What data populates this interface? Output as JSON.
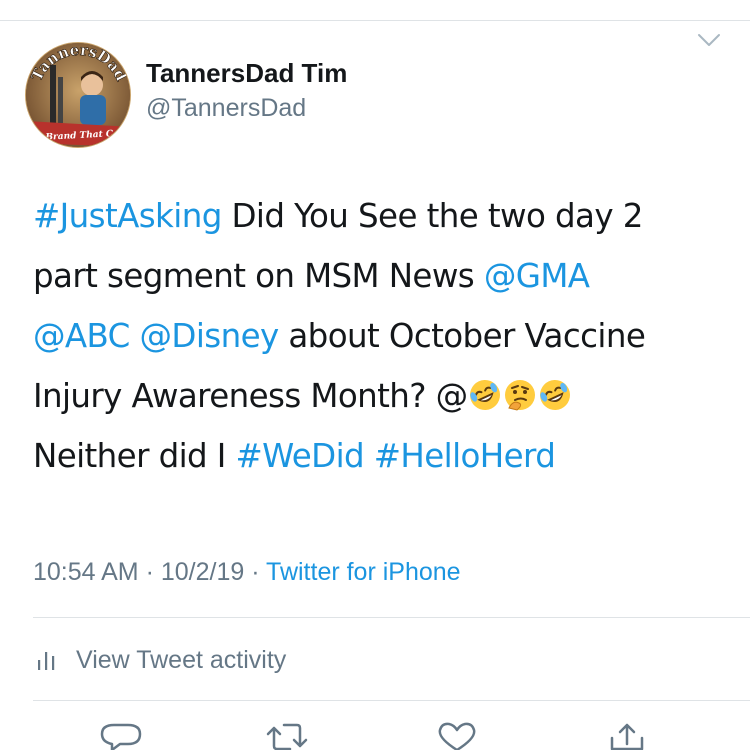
{
  "tweet": {
    "author": {
      "display_name": "TannersDad Tim",
      "handle": "@TannersDad",
      "avatar_text_top": "TannersDad",
      "avatar_text_bottom": "The Brand That Cares"
    },
    "text_lines": [
      [
        {
          "text": "#JustAsking",
          "type": "hashtag"
        },
        {
          "text": " Did You See the two day 2",
          "type": "text"
        }
      ],
      [
        {
          "text": "part segment on MSM News ",
          "type": "text"
        },
        {
          "text": "@GMA",
          "type": "mention"
        }
      ],
      [
        {
          "text": "@ABC",
          "type": "mention"
        },
        {
          "text": " ",
          "type": "text"
        },
        {
          "text": "@Disney",
          "type": "mention"
        },
        {
          "text": " about October Vaccine",
          "type": "text"
        }
      ],
      [
        {
          "text": "Injury Awareness Month? @",
          "type": "text"
        },
        {
          "emoji": "rofl",
          "type": "emoji"
        },
        {
          "emoji": "thinking",
          "type": "emoji"
        },
        {
          "emoji": "rofl",
          "type": "emoji"
        }
      ],
      [
        {
          "text": "Neither did I ",
          "type": "text"
        },
        {
          "text": "#WeDid",
          "type": "hashtag"
        },
        {
          "text": " ",
          "type": "text"
        },
        {
          "text": "#HelloHerd",
          "type": "hashtag"
        }
      ]
    ],
    "time": "10:54 AM",
    "separator": " · ",
    "date": "10/2/19",
    "source": "Twitter for iPhone",
    "activity_label": "View Tweet activity"
  },
  "colors": {
    "link": "#1b95e0",
    "text": "#14171a",
    "secondary": "#657786",
    "divider": "#dfe3e6"
  },
  "icons": {
    "menu": "chevron-down-icon",
    "activity": "bar-chart-icon",
    "reply": "reply-icon",
    "retweet": "retweet-icon",
    "like": "heart-icon",
    "share": "share-icon"
  }
}
